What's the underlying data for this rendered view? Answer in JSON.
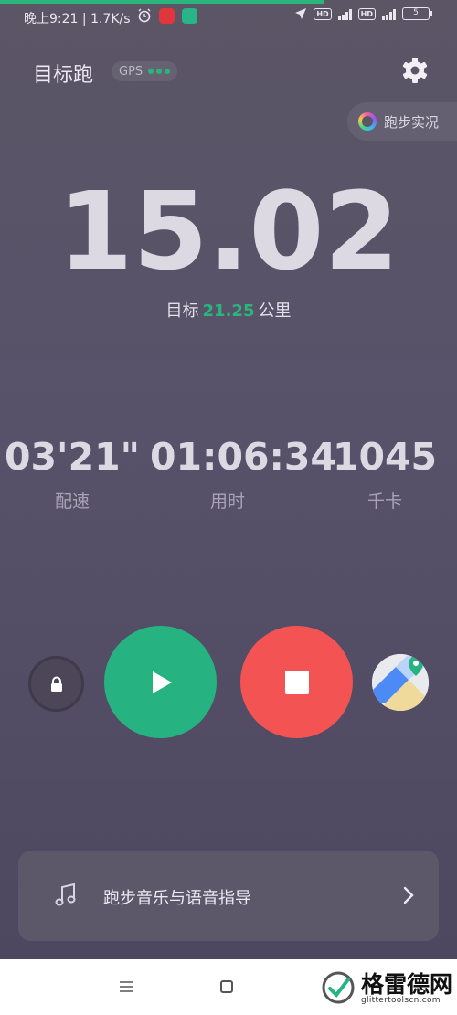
{
  "status_bar": {
    "time": "晚上9:21",
    "network_speed": "1.7K/s",
    "hd_badge_1": "HD",
    "hd_badge_2": "HD",
    "battery": "5"
  },
  "header": {
    "title": "目标跑",
    "gps_label": "GPS",
    "live_button_label": "跑步实况"
  },
  "run": {
    "distance": "15.02",
    "goal_prefix": "目标",
    "goal_value": "21.25",
    "goal_unit": "公里"
  },
  "metrics": [
    {
      "value": "03'21\"",
      "label": "配速"
    },
    {
      "value": "01:06:34",
      "label": "用时"
    },
    {
      "value": "1045",
      "label": "千卡"
    }
  ],
  "music_card": {
    "label": "跑步音乐与语音指导"
  },
  "watermark": {
    "name": "格雷德网",
    "url": "glittertoolscn.com"
  },
  "colors": {
    "accent_green": "#27b381",
    "stop_red": "#f35453",
    "background": "#57526a"
  },
  "icons": [
    "alarm-icon",
    "gear-icon",
    "live-ring-icon",
    "lock-icon",
    "play-icon",
    "stop-icon",
    "map-icon",
    "music-note-icon",
    "chevron-right-icon",
    "menu-icon",
    "home-icon"
  ]
}
